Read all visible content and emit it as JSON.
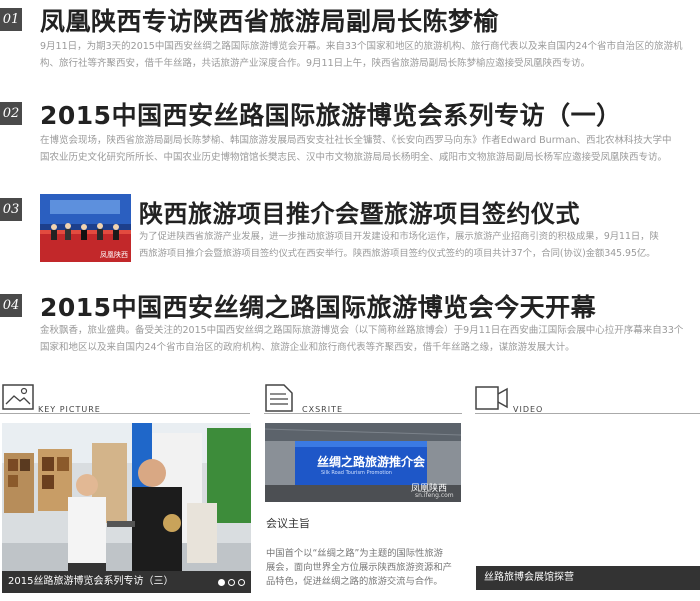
{
  "news": [
    {
      "num": "01",
      "title": "凤凰陕西专访陕西省旅游局副局长陈梦榆",
      "lines": [
        "9月11日，为期3天的2015中国西安丝绸之路国际旅游博览会开幕。来自33个国家和地区的旅游机构、旅行商代表以及来自国内24个省市自治区的旅游机",
        "构、旅行社等齐聚西安，借千年丝路，共话旅游产业深度合作。9月11日上午，陕西省旅游局副局长陈梦榆应邀接受凤凰陕西专访。"
      ]
    },
    {
      "num": "02",
      "title": "2015中国西安丝路国际旅游博览会系列专访（一）",
      "lines": [
        "在博览会现场，陕西省旅游局副局长陈梦榆、韩国旅游发展局西安支社社长全镛赞、《长安向西罗马向东》作者Edward Burman、西北农林科技大学中",
        "国农业历史文化研究所所长、中国农业历史博物馆馆长樊志民、汉中市文物旅游局局长杨明全、咸阳市文物旅游局副局长杨军应邀接受凤凰陕西专访。"
      ]
    },
    {
      "num": "03",
      "title": "陕西旅游项目推介会暨旅游项目签约仪式",
      "lines": [
        "为了促进陕西省旅游产业发展，进一步推动旅游项目开发建设和市场化运作，展示旅游产业招商引资的积极成果，9月11日，陕",
        "西旅游项目推介会暨旅游项目签约仪式在西安举行。陕西旅游项目签约仪式签约的项目共计37个，合同(协议)金额345.95亿。"
      ],
      "watermark": "凤凰陕西"
    },
    {
      "num": "04",
      "title": "2015中国西安丝绸之路国际旅游博览会今天开幕",
      "lines": [
        "金秋飘香，旅业盛典。备受关注的2015中国西安丝绸之路国际旅游博览会（以下简称丝路旅博会）于9月11日在西安曲江国际会展中心拉开序幕来自33个",
        "国家和地区以及来自国内24个省市自治区的政府机构、旅游企业和旅行商代表等齐聚西安，借千年丝路之缘，谋旅游发展大计。"
      ]
    }
  ],
  "columns": {
    "key_picture": {
      "label": "KEY PICTURE",
      "icon": "picture-icon",
      "caption": "2015丝路旅游博览会系列专访（三）",
      "slides": 3,
      "active_slide": 1
    },
    "cxsrite": {
      "label": "CXSRITE",
      "icon": "document-icon",
      "screen_title": "丝绸之路旅游推介会",
      "screen_sub": "Silk Road Tourism Promotion",
      "watermark": "凤凰陕西",
      "watermark_url": "sn.ifeng.com",
      "heading": "会议主旨",
      "lines": [
        "中国首个以“丝绸之路”为主题的国际性旅游",
        "展会，面向世界全方位展示陕西旅游资源和产",
        "品特色，促进丝绸之路的旅游交流与合作。"
      ]
    },
    "video": {
      "label": "VIDEO",
      "icon": "video-camera-icon",
      "caption": "丝路旅博会展馆探营"
    }
  },
  "colors": {
    "accent_dark": "#333333",
    "number_badge": "#4a4a4a",
    "desc_text": "#9a9a9a"
  }
}
